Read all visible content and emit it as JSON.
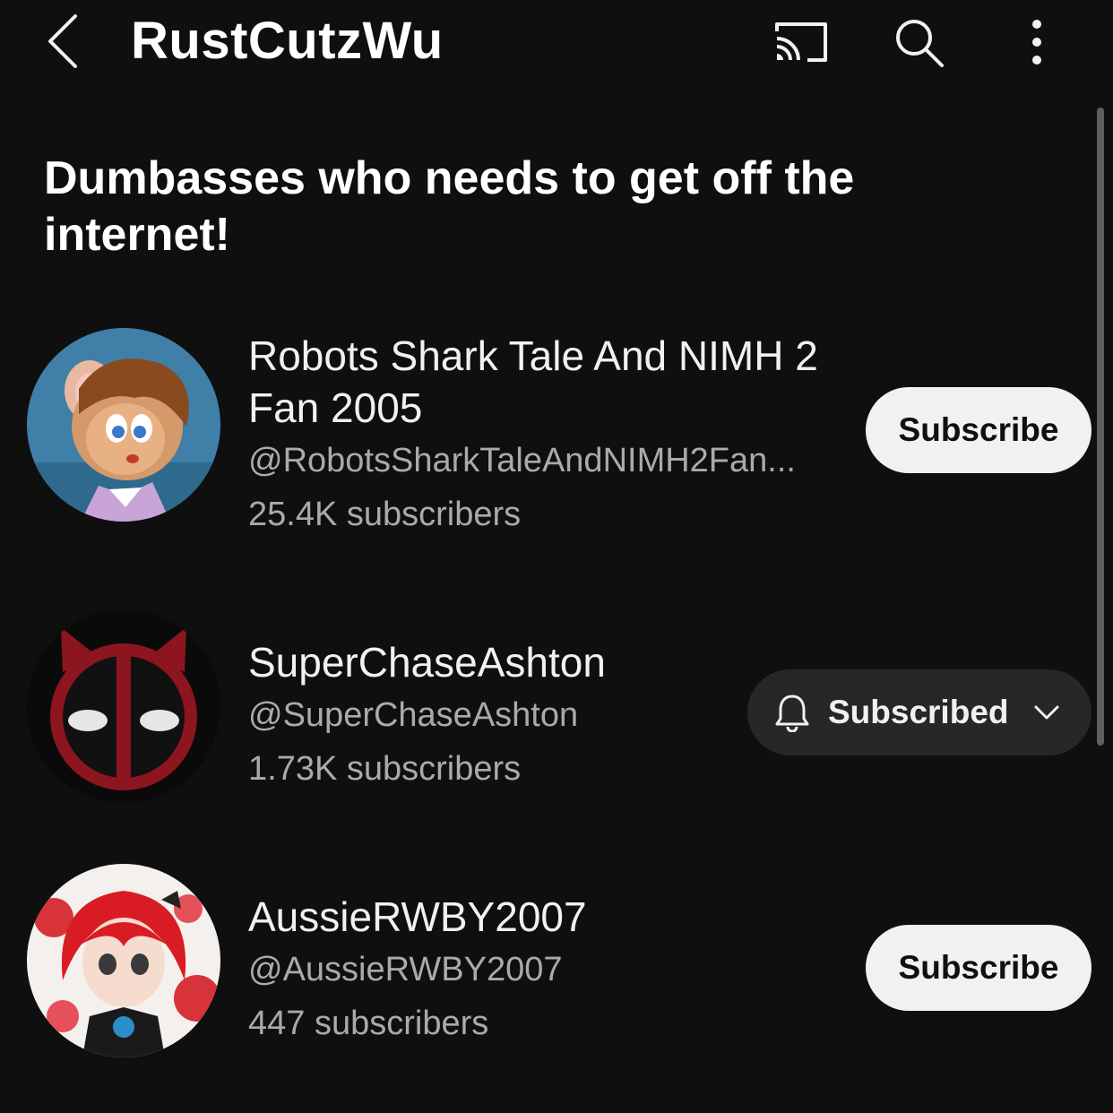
{
  "header": {
    "title": "RustCutzWu",
    "back_icon": "chevron-left-icon",
    "cast_icon": "cast-icon",
    "search_icon": "search-icon",
    "more_icon": "more-vertical-icon"
  },
  "section": {
    "title": "Dumbasses who needs to get off the internet!"
  },
  "channels": [
    {
      "name": "Robots Shark Tale And NIMH 2 Fan 2005",
      "handle": "@RobotsSharkTaleAndNIMH2Fan...",
      "subscribers": "25.4K subscribers",
      "button_label": "Subscribe",
      "subscribed": false
    },
    {
      "name": "SuperChaseAshton",
      "handle": "@SuperChaseAshton",
      "subscribers": "1.73K subscribers",
      "button_label": "Subscribed",
      "subscribed": true
    },
    {
      "name": "AussieRWBY2007",
      "handle": "@AussieRWBY2007",
      "subscribers": "447 subscribers",
      "button_label": "Subscribe",
      "subscribed": false
    }
  ],
  "colors": {
    "background": "#0f0f0f",
    "text_primary": "#f1f1f1",
    "text_secondary": "#aaaaaa",
    "subscribe_bg": "#f1f1f1",
    "subscribed_bg": "#272727"
  }
}
